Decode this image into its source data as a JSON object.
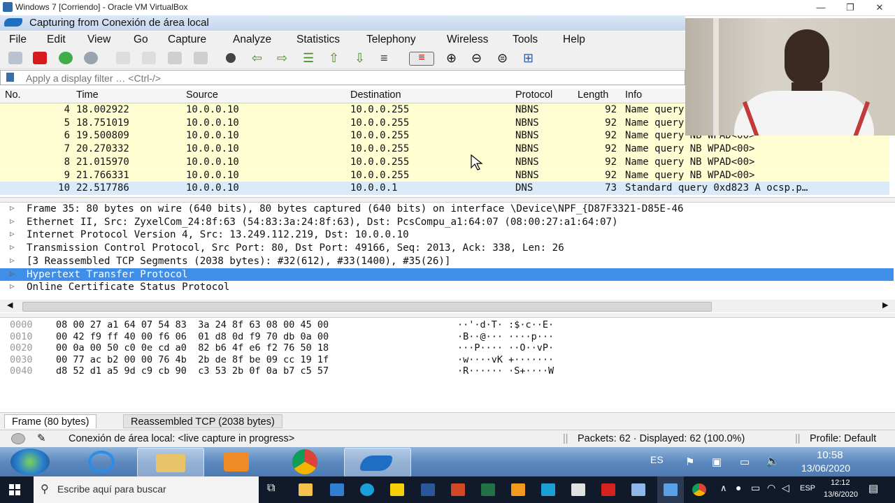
{
  "host_window": {
    "title": "Windows 7 [Corriendo] - Oracle VM VirtualBox"
  },
  "wireshark": {
    "title": "Capturing from Conexión de área local",
    "menu": [
      "File",
      "Edit",
      "View",
      "Go",
      "Capture",
      "Analyze",
      "Statistics",
      "Telephony",
      "Wireless",
      "Tools",
      "Help"
    ],
    "filter_placeholder": "Apply a display filter … <Ctrl-/>",
    "columns": {
      "no": "No.",
      "time": "Time",
      "source": "Source",
      "destination": "Destination",
      "protocol": "Protocol",
      "length": "Length",
      "info": "Info"
    },
    "packets": [
      {
        "no": "4",
        "time": "18.002922",
        "source": "10.0.0.10",
        "destination": "10.0.0.255",
        "protocol": "NBNS",
        "length": "92",
        "info": "Name query NB WPAD<00>"
      },
      {
        "no": "5",
        "time": "18.751019",
        "source": "10.0.0.10",
        "destination": "10.0.0.255",
        "protocol": "NBNS",
        "length": "92",
        "info": "Name query NB WPAD<00>"
      },
      {
        "no": "6",
        "time": "19.500809",
        "source": "10.0.0.10",
        "destination": "10.0.0.255",
        "protocol": "NBNS",
        "length": "92",
        "info": "Name query NB WPAD<00>"
      },
      {
        "no": "7",
        "time": "20.270332",
        "source": "10.0.0.10",
        "destination": "10.0.0.255",
        "protocol": "NBNS",
        "length": "92",
        "info": "Name query NB WPAD<00>"
      },
      {
        "no": "8",
        "time": "21.015970",
        "source": "10.0.0.10",
        "destination": "10.0.0.255",
        "protocol": "NBNS",
        "length": "92",
        "info": "Name query NB WPAD<00>"
      },
      {
        "no": "9",
        "time": "21.766331",
        "source": "10.0.0.10",
        "destination": "10.0.0.255",
        "protocol": "NBNS",
        "length": "92",
        "info": "Name query NB WPAD<00>"
      },
      {
        "no": "10",
        "time": "22.517786",
        "source": "10.0.0.10",
        "destination": "10.0.0.1",
        "protocol": "DNS",
        "length": "73",
        "info": "Standard query 0xd823 A ocsp.p…"
      }
    ],
    "details": [
      "Frame 35: 80 bytes on wire (640 bits), 80 bytes captured (640 bits) on interface \\Device\\NPF_{D87F3321-D85E-46",
      "Ethernet II, Src: ZyxelCom_24:8f:63 (54:83:3a:24:8f:63), Dst: PcsCompu_a1:64:07 (08:00:27:a1:64:07)",
      "Internet Protocol Version 4, Src: 13.249.112.219, Dst: 10.0.0.10",
      "Transmission Control Protocol, Src Port: 80, Dst Port: 49166, Seq: 2013, Ack: 338, Len: 26",
      "[3 Reassembled TCP Segments (2038 bytes): #32(612), #33(1400), #35(26)]",
      "Hypertext Transfer Protocol",
      "Online Certificate Status Protocol"
    ],
    "selected_detail": "Hypertext Transfer Protocol",
    "bytes": [
      {
        "offset": "0000",
        "hex": "08 00 27 a1 64 07 54 83  3a 24 8f 63 08 00 45 00",
        "ascii": "··'·d·T· :$·c··E·"
      },
      {
        "offset": "0010",
        "hex": "00 42 f9 ff 40 00 f6 06  01 d8 0d f9 70 db 0a 00",
        "ascii": "·B··@··· ····p···"
      },
      {
        "offset": "0020",
        "hex": "00 0a 00 50 c0 0e cd a0  82 b6 4f e6 f2 76 50 18",
        "ascii": "···P···· ··O··vP·"
      },
      {
        "offset": "0030",
        "hex": "00 77 ac b2 00 00 76 4b  2b de 8f be 09 cc 19 1f",
        "ascii": "·w····vK +·······"
      },
      {
        "offset": "0040",
        "hex": "d8 52 d1 a5 9d c9 cb 90  c3 53 2b 0f 0a b7 c5 57",
        "ascii": "·R······ ·S+····W"
      }
    ],
    "byte_tabs": [
      "Frame (80 bytes)",
      "Reassembled TCP (2038 bytes)"
    ],
    "status": {
      "capture": "Conexión de área local: <live capture in progress>",
      "packets": "Packets: 62 · Displayed: 62 (100.0%)",
      "profile": "Profile: Default"
    }
  },
  "win7_taskbar": {
    "lang": "ES",
    "time": "10:58",
    "date": "13/06/2020"
  },
  "win10_taskbar": {
    "search_placeholder": "Escribe aquí para buscar",
    "lang": "ESP",
    "time": "12:12",
    "date": "13/6/2020"
  },
  "colors": {
    "nbns_row": "#fefed2",
    "dns_row": "#dbeaf9",
    "selection": "#3f8ee8"
  }
}
